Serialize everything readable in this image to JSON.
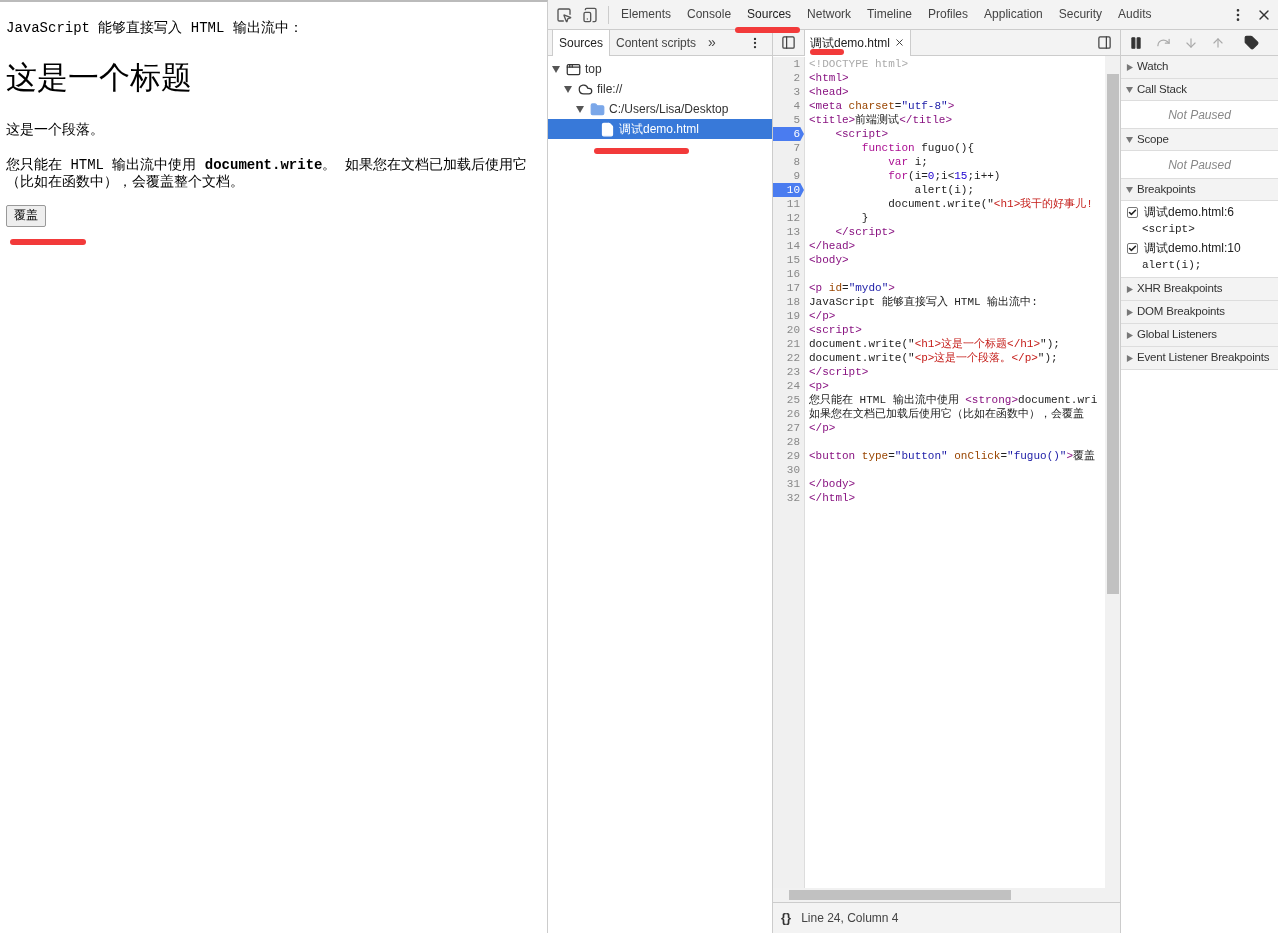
{
  "page": {
    "intro": "JavaScript 能够直接写入 HTML 输出流中：",
    "heading": "这是一个标题",
    "paragraph": "这是一个段落。",
    "note": "您只能在 HTML 输出流中使用 **document.write**。 如果您在文档已加载后使用它（比如在函数中），会覆盖整个文档。",
    "button": "覆盖"
  },
  "devtools": {
    "tabs": [
      {
        "label": "Elements",
        "selected": false
      },
      {
        "label": "Console",
        "selected": false
      },
      {
        "label": "Sources",
        "selected": true
      },
      {
        "label": "Network",
        "selected": false
      },
      {
        "label": "Timeline",
        "selected": false
      },
      {
        "label": "Profiles",
        "selected": false
      },
      {
        "label": "Application",
        "selected": false
      },
      {
        "label": "Security",
        "selected": false
      },
      {
        "label": "Audits",
        "selected": false
      }
    ],
    "navigator": {
      "tabs": [
        {
          "label": "Sources",
          "selected": true
        },
        {
          "label": "Content scripts",
          "selected": false
        }
      ],
      "more": "»",
      "tree": [
        {
          "kind": "frame",
          "label": "top",
          "expanded": true,
          "selected": false,
          "children": [
            {
              "kind": "cloud",
              "label": "file://",
              "expanded": true,
              "selected": false,
              "children": [
                {
                  "kind": "folder",
                  "label": "C:/Users/Lisa/Desktop",
                  "expanded": true,
                  "selected": false,
                  "children": [
                    {
                      "kind": "file",
                      "label": "调试demo.html",
                      "selected": true
                    }
                  ]
                }
              ]
            }
          ]
        }
      ]
    },
    "editor": {
      "tab": "调试demo.html",
      "lines": [
        {
          "number": "1",
          "breakpoint": false,
          "tokens": [
            {
              "kind": "comment",
              "text": "<!DOCTYPE html>"
            }
          ]
        },
        {
          "number": "2",
          "breakpoint": false,
          "tokens": [
            {
              "kind": "tag",
              "text": "<html>"
            }
          ]
        },
        {
          "number": "3",
          "breakpoint": false,
          "tokens": [
            {
              "kind": "tag",
              "text": "<head>"
            }
          ]
        },
        {
          "number": "4",
          "breakpoint": false,
          "tokens": [
            {
              "kind": "tag",
              "text": "<meta "
            },
            {
              "kind": "attr",
              "text": "charset"
            },
            {
              "kind": "text",
              "text": "="
            },
            {
              "kind": "value",
              "text": "\"utf-8\""
            },
            {
              "kind": "tag",
              "text": ">"
            }
          ]
        },
        {
          "number": "5",
          "breakpoint": false,
          "tokens": [
            {
              "kind": "tag",
              "text": "<title>"
            },
            {
              "kind": "text",
              "text": "前端测试"
            },
            {
              "kind": "tag",
              "text": "</title>"
            }
          ]
        },
        {
          "number": "6",
          "breakpoint": true,
          "tokens": [
            {
              "kind": "tag",
              "text": "    <script>"
            }
          ]
        },
        {
          "number": "7",
          "breakpoint": false,
          "tokens": [
            {
              "kind": "keyword",
              "text": "        function"
            },
            {
              "kind": "text",
              "text": " fuguo(){"
            }
          ]
        },
        {
          "number": "8",
          "breakpoint": false,
          "tokens": [
            {
              "kind": "keyword",
              "text": "            var"
            },
            {
              "kind": "text",
              "text": " i;"
            }
          ]
        },
        {
          "number": "9",
          "breakpoint": false,
          "tokens": [
            {
              "kind": "keyword",
              "text": "            for"
            },
            {
              "kind": "text",
              "text": "(i="
            },
            {
              "kind": "number",
              "text": "0"
            },
            {
              "kind": "text",
              "text": ";i<"
            },
            {
              "kind": "number",
              "text": "15"
            },
            {
              "kind": "text",
              "text": ";i++)"
            }
          ]
        },
        {
          "number": "10",
          "breakpoint": true,
          "tokens": [
            {
              "kind": "text",
              "text": "                alert(i);"
            }
          ]
        },
        {
          "number": "11",
          "breakpoint": false,
          "tokens": [
            {
              "kind": "text",
              "text": "            document.write(\""
            },
            {
              "kind": "string",
              "text": "<h1>我干的好事儿!"
            }
          ]
        },
        {
          "number": "12",
          "breakpoint": false,
          "tokens": [
            {
              "kind": "text",
              "text": "        }"
            }
          ]
        },
        {
          "number": "13",
          "breakpoint": false,
          "tokens": [
            {
              "kind": "tag",
              "text": "    </script>"
            }
          ]
        },
        {
          "number": "14",
          "breakpoint": false,
          "tokens": [
            {
              "kind": "tag",
              "text": "</head>"
            }
          ]
        },
        {
          "number": "15",
          "breakpoint": false,
          "tokens": [
            {
              "kind": "tag",
              "text": "<body>"
            }
          ]
        },
        {
          "number": "16",
          "breakpoint": false
        },
        {
          "number": "17",
          "breakpoint": false,
          "tokens": [
            {
              "kind": "tag",
              "text": "<p "
            },
            {
              "kind": "attr",
              "text": "id"
            },
            {
              "kind": "text",
              "text": "="
            },
            {
              "kind": "value",
              "text": "\"mydo\""
            },
            {
              "kind": "tag",
              "text": ">"
            }
          ]
        },
        {
          "number": "18",
          "breakpoint": false,
          "tokens": [
            {
              "kind": "text",
              "text": "JavaScript 能够直接写入 HTML 输出流中:"
            }
          ]
        },
        {
          "number": "19",
          "breakpoint": false,
          "tokens": [
            {
              "kind": "tag",
              "text": "</p>"
            }
          ]
        },
        {
          "number": "20",
          "breakpoint": false,
          "tokens": [
            {
              "kind": "tag",
              "text": "<script>"
            }
          ]
        },
        {
          "number": "21",
          "breakpoint": false,
          "tokens": [
            {
              "kind": "text",
              "text": "document.write(\""
            },
            {
              "kind": "string",
              "text": "<h1>这是一个标题</h1>"
            },
            {
              "kind": "text",
              "text": "\");"
            }
          ]
        },
        {
          "number": "22",
          "breakpoint": false,
          "tokens": [
            {
              "kind": "text",
              "text": "document.write(\""
            },
            {
              "kind": "string",
              "text": "<p>这是一个段落。</p>"
            },
            {
              "kind": "text",
              "text": "\");"
            }
          ]
        },
        {
          "number": "23",
          "breakpoint": false,
          "tokens": [
            {
              "kind": "tag",
              "text": "</script>"
            }
          ]
        },
        {
          "number": "24",
          "breakpoint": false,
          "tokens": [
            {
              "kind": "tag",
              "text": "<p>"
            }
          ]
        },
        {
          "number": "25",
          "breakpoint": false,
          "tokens": [
            {
              "kind": "text",
              "text": "您只能在 HTML 输出流中使用 "
            },
            {
              "kind": "tag",
              "text": "<strong>"
            },
            {
              "kind": "text",
              "text": "document.wri"
            }
          ]
        },
        {
          "number": "26",
          "breakpoint": false,
          "tokens": [
            {
              "kind": "text",
              "text": "如果您在文档已加载后使用它（比如在函数中），会覆盖"
            }
          ]
        },
        {
          "number": "27",
          "breakpoint": false,
          "tokens": [
            {
              "kind": "tag",
              "text": "</p>"
            }
          ]
        },
        {
          "number": "28",
          "breakpoint": false
        },
        {
          "number": "29",
          "breakpoint": false,
          "tokens": [
            {
              "kind": "tag",
              "text": "<button "
            },
            {
              "kind": "attr",
              "text": "type"
            },
            {
              "kind": "text",
              "text": "="
            },
            {
              "kind": "value",
              "text": "\"button\""
            },
            {
              "kind": "attr",
              "text": " onClick"
            },
            {
              "kind": "text",
              "text": "="
            },
            {
              "kind": "value",
              "text": "\"fuguo()\""
            },
            {
              "kind": "tag",
              "text": ">"
            },
            {
              "kind": "text",
              "text": "覆盖"
            }
          ]
        },
        {
          "number": "30",
          "breakpoint": false
        },
        {
          "number": "31",
          "breakpoint": false,
          "tokens": [
            {
              "kind": "tag",
              "text": "</body>"
            }
          ]
        },
        {
          "number": "32",
          "breakpoint": false,
          "tokens": [
            {
              "kind": "tag",
              "text": "</html>"
            }
          ]
        }
      ],
      "format": "{}",
      "status": "Line 24, Column 4"
    },
    "sidebar": [
      {
        "title": "Watch",
        "expanded": false
      },
      {
        "title": "Call Stack",
        "expanded": true,
        "message": "Not Paused"
      },
      {
        "title": "Scope",
        "expanded": true,
        "message": "Not Paused"
      },
      {
        "title": "Breakpoints",
        "expanded": true,
        "items": [
          {
            "file": "调试demo.html:6",
            "code": "<script>",
            "checked": true
          },
          {
            "file": "调试demo.html:10",
            "code": "alert(i);",
            "checked": true
          }
        ]
      },
      {
        "title": "XHR Breakpoints",
        "expanded": false
      },
      {
        "title": "DOM Breakpoints",
        "expanded": false
      },
      {
        "title": "Global Listeners",
        "expanded": false
      },
      {
        "title": "Event Listener Breakpoints",
        "expanded": false
      }
    ]
  }
}
